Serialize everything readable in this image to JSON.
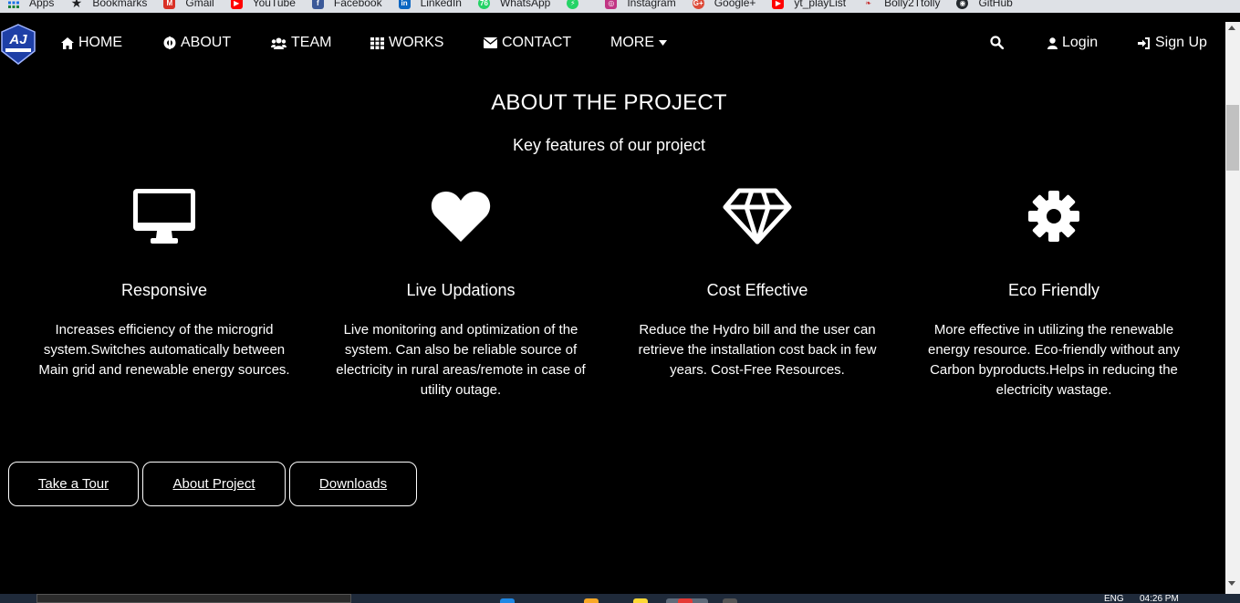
{
  "bookmarks": [
    {
      "label": "Apps",
      "icon": "apps-grid-icon",
      "color": "#e8710a"
    },
    {
      "label": "Bookmarks",
      "icon": "star-icon",
      "color": "#202124"
    },
    {
      "label": "Gmail",
      "icon": "gmail-icon",
      "color": "#d93025"
    },
    {
      "label": "YouTube",
      "icon": "youtube-icon",
      "color": "#ff0000"
    },
    {
      "label": "Facebook",
      "icon": "facebook-icon",
      "color": "#3b5998"
    },
    {
      "label": "LinkedIn",
      "icon": "linkedin-icon",
      "color": "#0a66c2"
    },
    {
      "label": "WhatsApp",
      "icon": "whatsapp-icon",
      "color": "#25d366"
    },
    {
      "label": "",
      "icon": "bolt-icon",
      "color": "#25d366"
    },
    {
      "label": "Instagram",
      "icon": "instagram-icon",
      "color": "#c13584"
    },
    {
      "label": "Google+",
      "icon": "google-plus-icon",
      "color": "#dd4b39"
    },
    {
      "label": "yt_playList",
      "icon": "youtube-icon",
      "color": "#ff0000"
    },
    {
      "label": "Bolly2Ttolly",
      "icon": "bolly-icon",
      "color": "#c62828"
    },
    {
      "label": "GitHub",
      "icon": "github-icon",
      "color": "#24292e"
    }
  ],
  "nav": {
    "logo": "AJ",
    "home": "HOME",
    "about": "ABOUT",
    "team": "TEAM",
    "works": "WORKS",
    "contact": "CONTACT",
    "more": "MORE",
    "login": "Login",
    "signup": "Sign Up"
  },
  "hero": {
    "title": "ABOUT THE PROJECT",
    "subtitle": "Key features of our project"
  },
  "features": [
    {
      "icon": "desktop-icon",
      "title": "Responsive",
      "text": "Increases efficiency of the microgrid system.Switches automatically between Main grid and renewable energy sources."
    },
    {
      "icon": "heart-icon",
      "title": "Live Updations",
      "text": "Live monitoring and optimization of the system. Can also be reliable source of electricity in rural areas/remote in case of utility outage."
    },
    {
      "icon": "diamond-icon",
      "title": "Cost Effective",
      "text": "Reduce the Hydro bill and the user can retrieve the installation cost back in few years. Cost-Free Resources."
    },
    {
      "icon": "gear-icon",
      "title": "Eco Friendly",
      "text": "More effective in utilizing the renewable energy resource. Eco-friendly without any Carbon byproducts.Helps in reducing the electricity wastage."
    }
  ],
  "buttons": {
    "tour": "Take a Tour",
    "about_project": "About Project",
    "downloads": "Downloads"
  },
  "taskbar": {
    "lang": "ENG",
    "time": "04:26 PM"
  }
}
